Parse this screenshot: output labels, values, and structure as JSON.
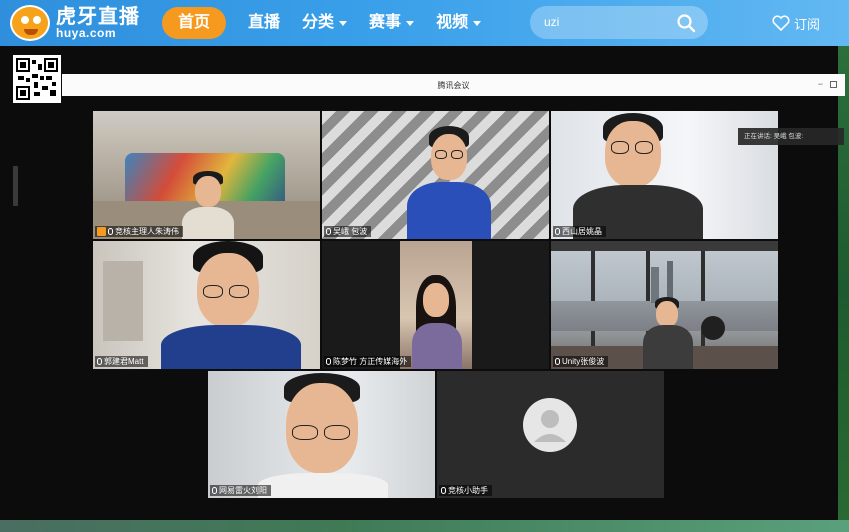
{
  "site": {
    "logo_cn": "虎牙直播",
    "logo_en": "huya.com"
  },
  "nav": {
    "items": [
      {
        "label": "首页",
        "active": true,
        "dropdown": false
      },
      {
        "label": "直播",
        "active": false,
        "dropdown": false
      },
      {
        "label": "分类",
        "active": false,
        "dropdown": true
      },
      {
        "label": "赛事",
        "active": false,
        "dropdown": true
      },
      {
        "label": "视频",
        "active": false,
        "dropdown": true
      }
    ]
  },
  "search": {
    "value": "uzi",
    "icon": "search-icon"
  },
  "subscribe": {
    "label": "订阅",
    "icon": "heart-icon"
  },
  "meeting": {
    "title": "腾讯会议",
    "speaking_label": "正在讲话: 吴峨 包波:",
    "participants": [
      {
        "name": "竞核主理人朱涛伟",
        "host": true
      },
      {
        "name": "吴峨 包波",
        "host": false
      },
      {
        "name": "西山居姚晶",
        "host": false
      },
      {
        "name": "郭建君Matt",
        "host": false
      },
      {
        "name": "陈梦竹 方正传媒海外",
        "host": false
      },
      {
        "name": "Unity张俊波",
        "host": false
      },
      {
        "name": "网易雷火刘阳",
        "host": false
      },
      {
        "name": "竞核小助手",
        "host": false
      }
    ]
  },
  "colors": {
    "header_blue": "#3aa0ea",
    "nav_active": "#f59a1f",
    "tile_grey": "#2b2b2b"
  }
}
